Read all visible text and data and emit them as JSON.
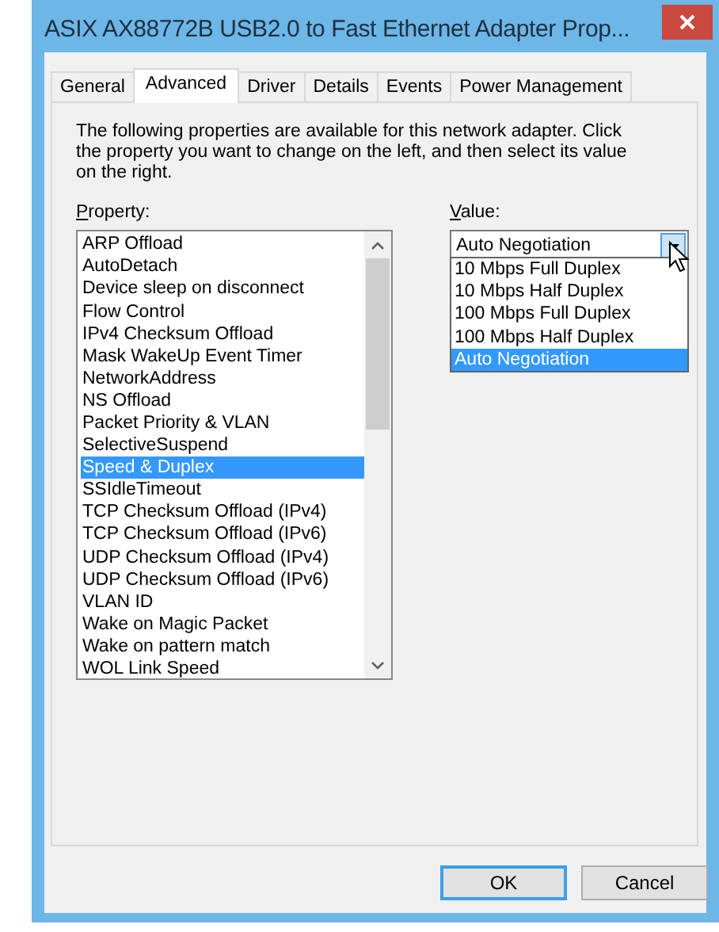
{
  "window": {
    "title": "ASIX AX88772B USB2.0 to Fast Ethernet Adapter Prop..."
  },
  "tabs": [
    {
      "label": "General",
      "selected": false
    },
    {
      "label": "Advanced",
      "selected": true
    },
    {
      "label": "Driver",
      "selected": false
    },
    {
      "label": "Details",
      "selected": false
    },
    {
      "label": "Events",
      "selected": false
    },
    {
      "label": "Power Management",
      "selected": false
    }
  ],
  "description": "The following properties are available for this network adapter. Click the property you want to change on the left, and then select its value on the right.",
  "property_label": "Property:",
  "properties": [
    {
      "label": "ARP Offload",
      "selected": false
    },
    {
      "label": "AutoDetach",
      "selected": false
    },
    {
      "label": "Device sleep on disconnect",
      "selected": false
    },
    {
      "label": "Flow Control",
      "selected": false
    },
    {
      "label": "IPv4 Checksum Offload",
      "selected": false
    },
    {
      "label": "Mask WakeUp Event Timer",
      "selected": false
    },
    {
      "label": "NetworkAddress",
      "selected": false
    },
    {
      "label": "NS Offload",
      "selected": false
    },
    {
      "label": "Packet Priority & VLAN",
      "selected": false
    },
    {
      "label": "SelectiveSuspend",
      "selected": false
    },
    {
      "label": "Speed & Duplex",
      "selected": true
    },
    {
      "label": "SSIdleTimeout",
      "selected": false
    },
    {
      "label": "TCP Checksum Offload (IPv4)",
      "selected": false
    },
    {
      "label": "TCP Checksum Offload (IPv6)",
      "selected": false
    },
    {
      "label": "UDP Checksum Offload (IPv4)",
      "selected": false
    },
    {
      "label": "UDP Checksum Offload (IPv6)",
      "selected": false
    },
    {
      "label": "VLAN ID",
      "selected": false
    },
    {
      "label": "Wake on Magic Packet",
      "selected": false
    },
    {
      "label": "Wake on pattern match",
      "selected": false
    },
    {
      "label": "WOL Link Speed",
      "selected": false
    }
  ],
  "value_label": "Value:",
  "value_combo": {
    "value": "Auto Negotiation",
    "expanded": true
  },
  "value_options": [
    {
      "label": "10 Mbps Full Duplex",
      "selected": false
    },
    {
      "label": "10 Mbps Half Duplex",
      "selected": false
    },
    {
      "label": "100 Mbps Full Duplex",
      "selected": false
    },
    {
      "label": "100 Mbps Half Duplex",
      "selected": false
    },
    {
      "label": "Auto Negotiation",
      "selected": true
    }
  ],
  "buttons": [
    {
      "label": "OK",
      "default": true
    },
    {
      "label": "Cancel",
      "default": false
    }
  ]
}
